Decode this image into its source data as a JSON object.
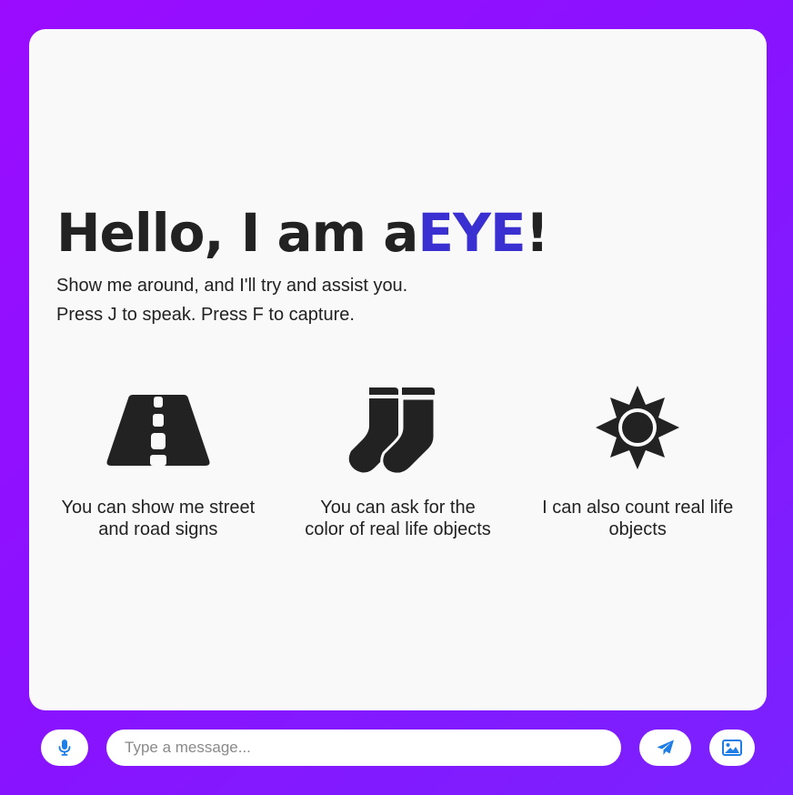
{
  "hero": {
    "title_prefix": "Hello, I am a",
    "title_brand": "EYE",
    "title_suffix": "!",
    "line1": "Show me around, and I'll try and assist you.",
    "line2": "Press J to speak. Press F to capture."
  },
  "features": [
    {
      "icon": "road-icon",
      "text_line1": "You can show me street",
      "text_line2": "and road signs"
    },
    {
      "icon": "socks-icon",
      "text_line1": "You can ask for the",
      "text_line2": "color of real life objects"
    },
    {
      "icon": "sun-icon",
      "text_line1": "I can also count real life",
      "text_line2": "objects"
    }
  ],
  "composer": {
    "placeholder": "Type a message...",
    "mic_icon": "microphone-icon",
    "send_icon": "paper-plane-icon",
    "image_icon": "image-icon"
  },
  "colors": {
    "accent": "#3a2fd0",
    "button_icon": "#1e7ee6",
    "text": "#222222",
    "card_bg": "#f9f9f9"
  }
}
